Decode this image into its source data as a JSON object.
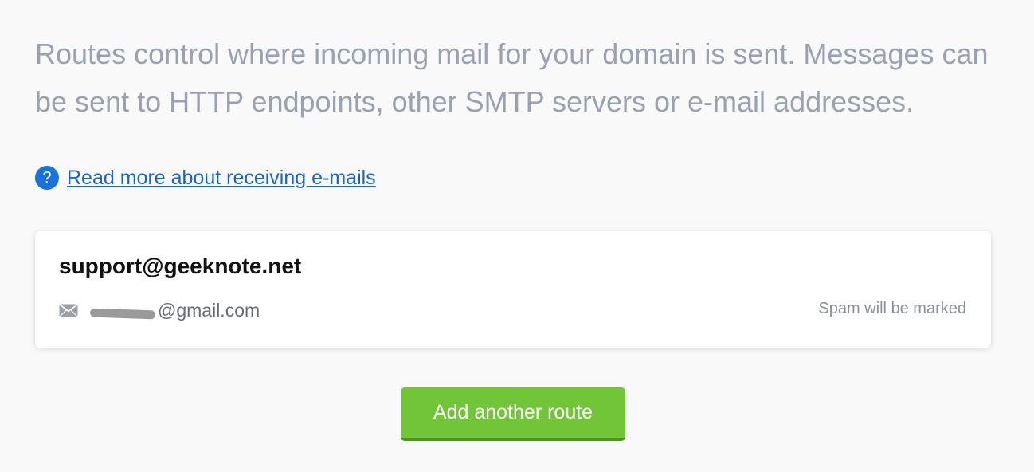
{
  "intro": {
    "text": "Routes control where incoming mail for your domain is sent. Messages can be sent to HTTP endpoints, other SMTP servers or e-mail addresses."
  },
  "help": {
    "icon": "question-mark-icon",
    "icon_glyph": "?",
    "link_label": "Read more about receiving e-mails",
    "icon_color": "#1a73d9",
    "link_color": "#1a63c7"
  },
  "routes": [
    {
      "address": "support@geeknote.net",
      "destination_icon": "envelope-icon",
      "destination_visible": "@gmail.com",
      "spam_status": "Spam will be marked"
    }
  ],
  "actions": {
    "add_route_label": "Add another route",
    "button_color": "#72c539"
  }
}
